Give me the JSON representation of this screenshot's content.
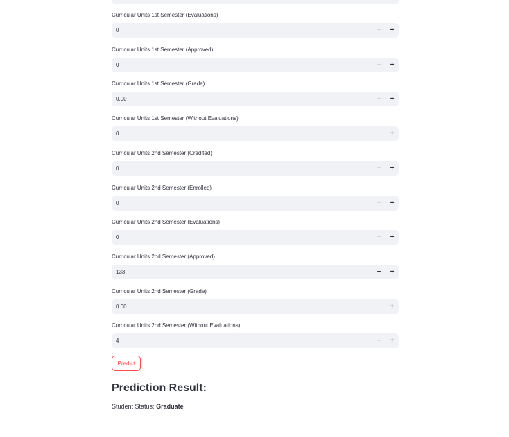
{
  "fields": [
    {
      "label": "Curricular Units 1st Semester (Evaluations)",
      "value": "0",
      "minus_enabled": false
    },
    {
      "label": "Curricular Units 1st Semester (Approved)",
      "value": "0",
      "minus_enabled": false
    },
    {
      "label": "Curricular Units 1st Semester (Grade)",
      "value": "0.00",
      "minus_enabled": false
    },
    {
      "label": "Curricular Units 1st Semester (Without Evaluations)",
      "value": "0",
      "minus_enabled": false
    },
    {
      "label": "Curricular Units 2nd Semester (Credited)",
      "value": "0",
      "minus_enabled": false
    },
    {
      "label": "Curricular Units 2nd Semester (Enrolled)",
      "value": "0",
      "minus_enabled": false
    },
    {
      "label": "Curricular Units 2nd Semester (Evaluations)",
      "value": "0",
      "minus_enabled": false
    },
    {
      "label": "Curricular Units 2nd Semester (Approved)",
      "value": "133",
      "minus_enabled": true
    },
    {
      "label": "Curricular Units 2nd Semester (Grade)",
      "value": "0.00",
      "minus_enabled": false
    },
    {
      "label": "Curricular Units 2nd Semester (Without Evaluations)",
      "value": "4",
      "minus_enabled": true
    }
  ],
  "stepper": {
    "minus_symbol": "−",
    "plus_symbol": "+"
  },
  "predict_button": {
    "label": "Predict"
  },
  "result": {
    "heading": "Prediction Result:",
    "status_label": "Student Status:",
    "status_value": "Graduate"
  },
  "colors": {
    "accent": "#ff4b4b",
    "input_bg": "#f0f2f6",
    "text": "#31333f",
    "disabled": "#c8cad0"
  }
}
